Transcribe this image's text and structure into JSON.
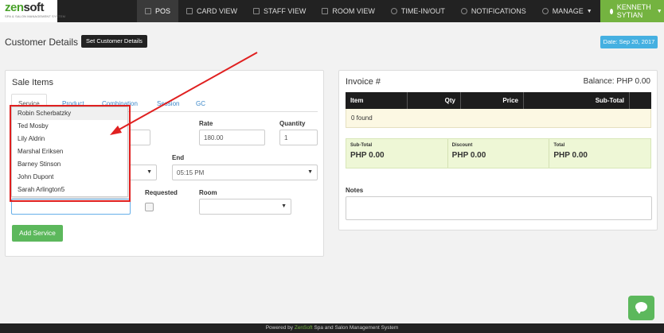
{
  "brand": {
    "logo_a": "zen",
    "logo_b": "soft",
    "tagline": "SPA & SALON MANAGEMENT SYSTEM"
  },
  "nav": {
    "items": [
      {
        "label": "POS",
        "icon": "pos-icon"
      },
      {
        "label": "CARD VIEW",
        "icon": "card-icon"
      },
      {
        "label": "STAFF VIEW",
        "icon": "staff-icon"
      },
      {
        "label": "ROOM VIEW",
        "icon": "room-icon"
      },
      {
        "label": "TIME-IN/OUT",
        "icon": "clock-icon"
      },
      {
        "label": "NOTIFICATIONS",
        "icon": "bell-icon"
      },
      {
        "label": "MANAGE",
        "icon": "gear-icon"
      }
    ],
    "user": "KENNETH SYTIAN",
    "accent": "#74b340"
  },
  "header": {
    "title": "Customer Details",
    "set_customer_btn": "Set Customer Details",
    "date": "Date: Sep 20, 2017"
  },
  "sale": {
    "title": "Sale Items",
    "tabs": [
      "Service",
      "Product",
      "Combination",
      "Session",
      "GC"
    ],
    "rate_label": "Rate",
    "rate_value": "180.00",
    "quantity_label": "Quantity",
    "quantity_value": "1",
    "end_label": "End",
    "end_value": "05:15 PM",
    "requested_label": "Requested",
    "room_label": "Room",
    "add_btn": "Add Service",
    "staff_options": [
      "Robin Scherbatzky",
      "Ted Mosby",
      "Lily Aldrin",
      "Marshal Eriksen",
      "Barney Stinson",
      "John Dupont",
      "Sarah Arlington5"
    ]
  },
  "invoice": {
    "title": "Invoice #",
    "balance": "Balance: PHP 0.00",
    "columns": [
      "Item",
      "Qty",
      "Price",
      "Sub-Total"
    ],
    "empty": "0 found",
    "subtotal_label": "Sub-Total",
    "subtotal_value": "PHP 0.00",
    "discount_label": "Discount",
    "discount_value": "PHP 0.00",
    "total_label": "Total",
    "total_value": "PHP 0.00",
    "notes_label": "Notes"
  },
  "footer": {
    "prefix": "Powered by ",
    "brand": "ZenSoft",
    "suffix": " Spa and Salon Management System"
  }
}
